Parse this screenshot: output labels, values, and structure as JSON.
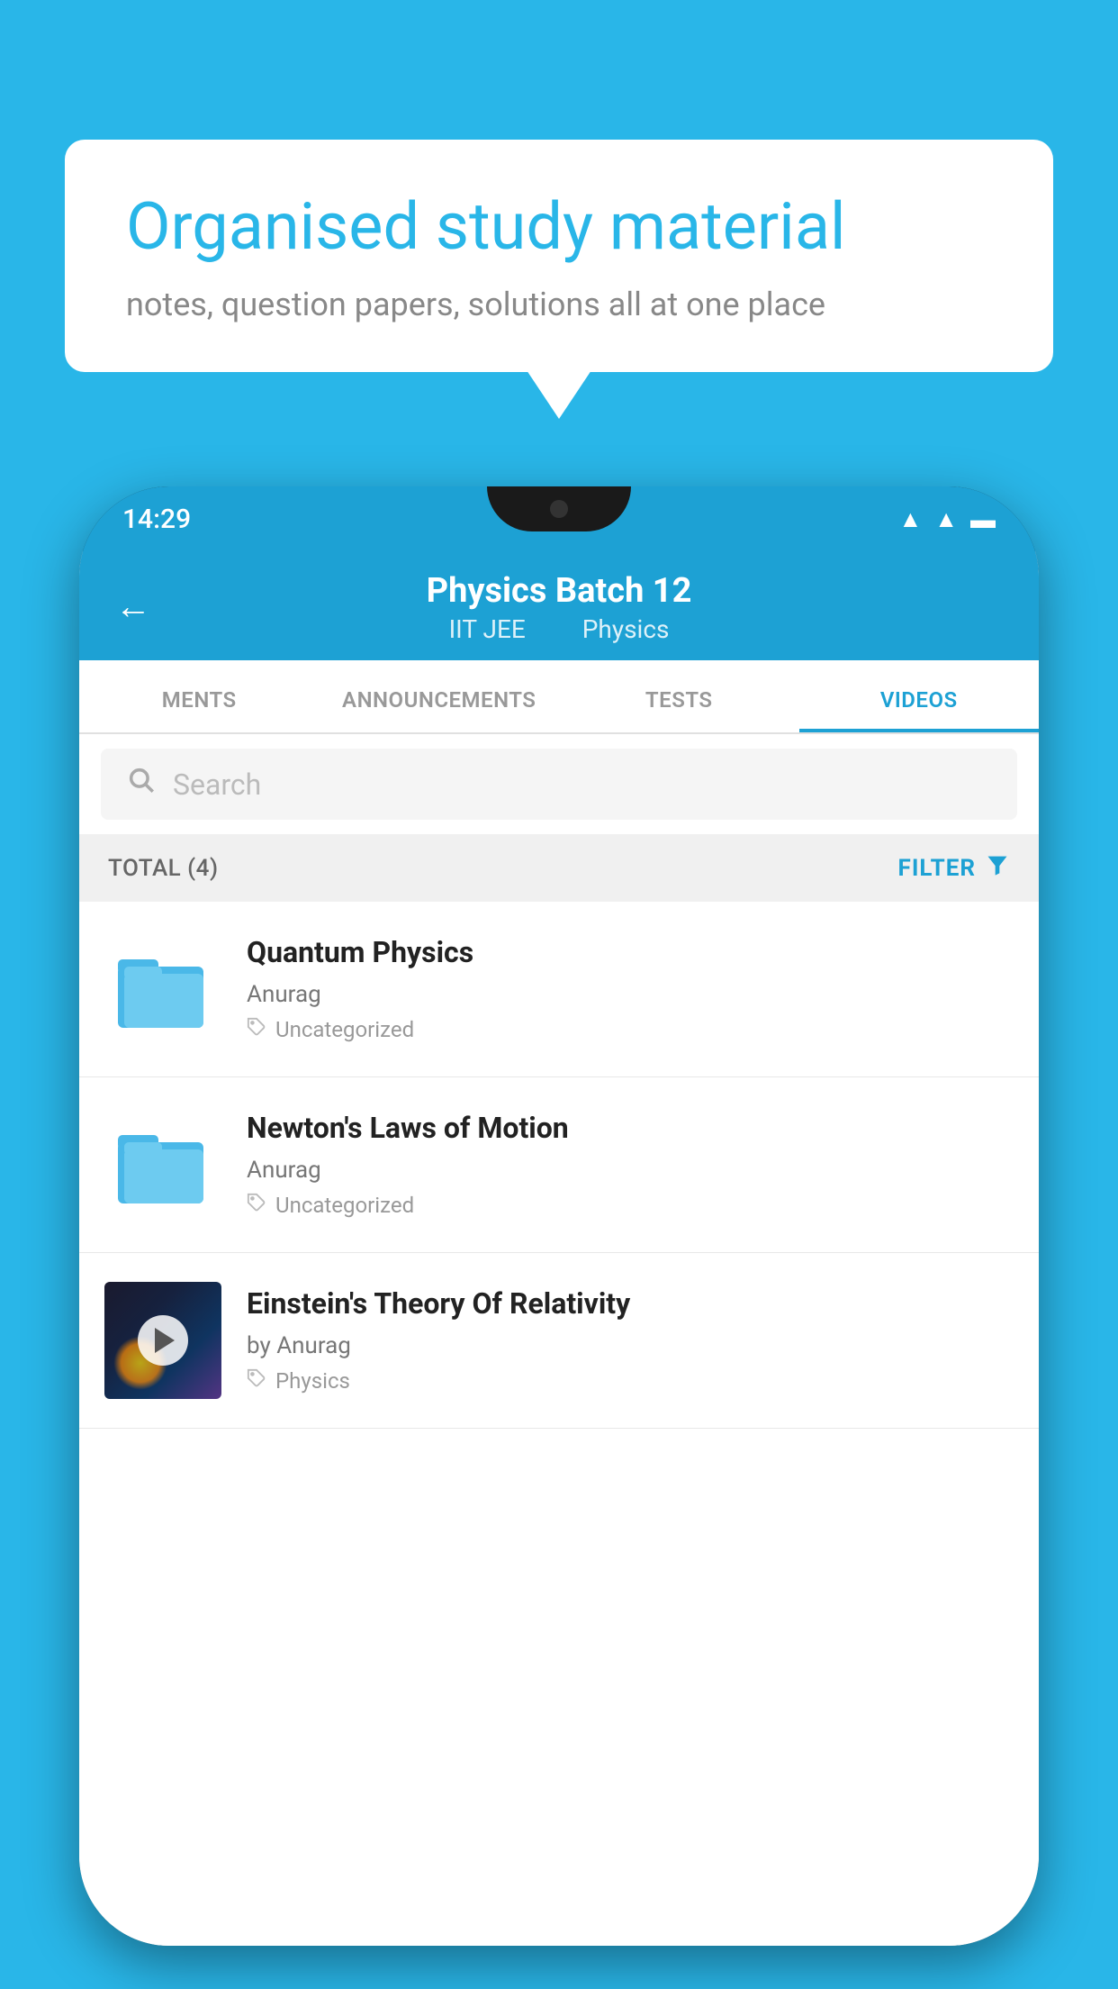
{
  "background_color": "#29b6e8",
  "speech_bubble": {
    "title": "Organised study material",
    "subtitle": "notes, question papers, solutions all at one place"
  },
  "phone": {
    "status_bar": {
      "time": "14:29",
      "icons": [
        "wifi",
        "signal",
        "battery"
      ]
    },
    "header": {
      "back_label": "←",
      "title": "Physics Batch 12",
      "subtitle_part1": "IIT JEE",
      "subtitle_part2": "Physics"
    },
    "tabs": [
      {
        "label": "MENTS",
        "active": false
      },
      {
        "label": "ANNOUNCEMENTS",
        "active": false
      },
      {
        "label": "TESTS",
        "active": false
      },
      {
        "label": "VIDEOS",
        "active": true
      }
    ],
    "search": {
      "placeholder": "Search"
    },
    "filter_bar": {
      "total_label": "TOTAL (4)",
      "filter_label": "FILTER"
    },
    "videos": [
      {
        "title": "Quantum Physics",
        "author": "Anurag",
        "tag": "Uncategorized",
        "type": "folder",
        "has_thumbnail": false
      },
      {
        "title": "Newton's Laws of Motion",
        "author": "Anurag",
        "tag": "Uncategorized",
        "type": "folder",
        "has_thumbnail": false
      },
      {
        "title": "Einstein's Theory Of Relativity",
        "author": "by Anurag",
        "tag": "Physics",
        "type": "video",
        "has_thumbnail": true
      }
    ]
  }
}
